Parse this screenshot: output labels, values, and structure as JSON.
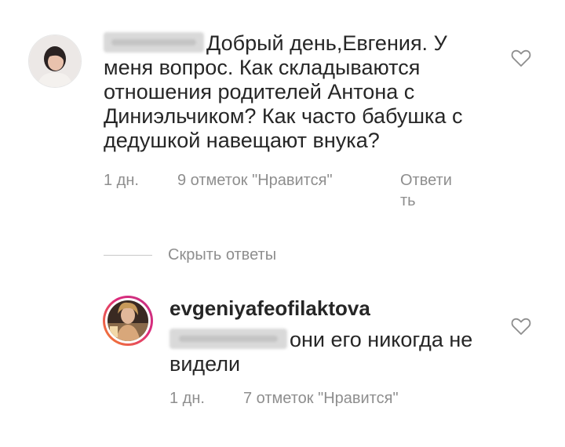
{
  "comment1": {
    "avatar_icon": "user-avatar-photo",
    "text": "Добрый день,Евгения. У меня вопрос. Как складываются отношения  родителей Антона с Диниэльчиком? Как часто бабушка с дедушкой навещают внука?",
    "time": "1 дн.",
    "likes": "9 отметок \"Нравится\"",
    "reply_line1": "Ответи",
    "reply_line2": "ть",
    "like_icon": "heart-outline-icon"
  },
  "replies": {
    "hide_label": "Скрыть ответы"
  },
  "comment2": {
    "avatar_icon": "story-ring-avatar-photo",
    "username": "evgeniyafeofilaktova",
    "text": "они его никогда не видели",
    "time": "1 дн.",
    "likes": "7 отметок \"Нравится\"",
    "like_icon": "heart-outline-icon"
  },
  "colors": {
    "text": "#262626",
    "secondary": "#8e8e8e",
    "story_ring_start": "#f58529",
    "story_ring_end": "#dd2a7b"
  }
}
